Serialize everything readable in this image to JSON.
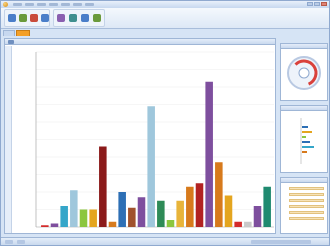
{
  "window": {
    "menu_count": 7
  },
  "document": {
    "tabs": [
      "",
      ""
    ],
    "panel_title": ""
  },
  "colors": {
    "accent_tab": "#f4a028",
    "ribbon_icons": [
      "#4a7ec9",
      "#6a9a3c",
      "#c94b3b",
      "#4a7ec9",
      "#8a5fb0",
      "#3f8f8f",
      "#4a7ec9",
      "#6a9a3c"
    ]
  },
  "chart_data": {
    "type": "bar",
    "ylim": [
      0,
      100
    ],
    "grid": true,
    "series_colors": [
      "#d42c2c",
      "#7e4f9e",
      "#35a6c9",
      "#9fc7dc",
      "#8cc63f",
      "#e4a51f",
      "#8b1a1a",
      "#d77a1c",
      "#2d6fb5",
      "#a0522d",
      "#7e4f9e",
      "#9fc7dc",
      "#2e8b57",
      "#8cc63f",
      "#e8b43a",
      "#d77a1c",
      "#b22222",
      "#7e4f9e",
      "#d77a1c",
      "#e4a51f",
      "#d42c2c",
      "#c9c9c9",
      "#7e4f9e",
      "#1f8a70"
    ],
    "values": [
      1,
      2,
      12,
      21,
      10,
      10,
      46,
      3,
      20,
      11,
      17,
      69,
      15,
      4,
      15,
      23,
      25,
      83,
      37,
      18,
      3,
      3,
      12,
      23
    ]
  },
  "side": {
    "gauge_value": 0.75,
    "list_rows": 6
  },
  "status": {
    "segments": 3
  }
}
